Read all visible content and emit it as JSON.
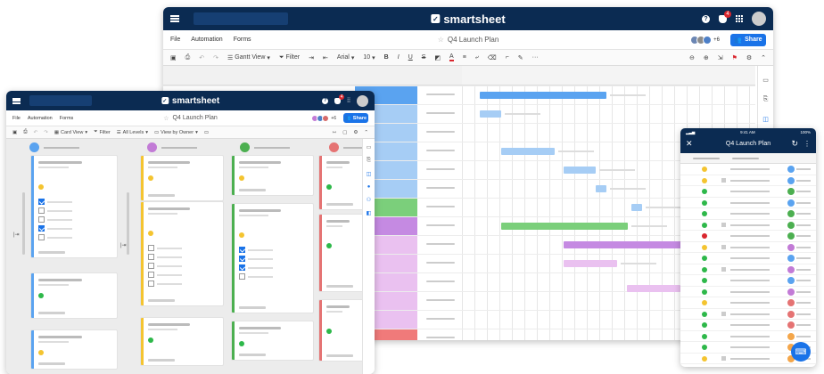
{
  "brand": {
    "name": "smartsheet",
    "logo_glyph": "✓"
  },
  "back_window": {
    "menus": [
      "File",
      "Automation",
      "Forms"
    ],
    "sheet_title": "Q4 Launch Plan",
    "collab_count": "+6",
    "share_label": "Share",
    "notif_count": "4",
    "toolbar": {
      "view": "Gantt View",
      "filter": "Filter",
      "font": "Arial",
      "size": "10"
    },
    "row_colors": [
      "#5aa3f0",
      "#a6cdf5",
      "#a6cdf5",
      "#a6cdf5",
      "#a6cdf5",
      "#a6cdf5",
      "#7bcf7b",
      "#c58ae2",
      "#eac1f0",
      "#eac1f0",
      "#eac1f0",
      "#eac1f0",
      "#eac1f0",
      "#f07a7a"
    ]
  },
  "front_window": {
    "menus": [
      "File",
      "Automation",
      "Forms"
    ],
    "sheet_title": "Q4 Launch Plan",
    "collab_count": "+6",
    "share_label": "Share",
    "notif_count": "4",
    "toolbar": {
      "view": "Card View",
      "filter": "Filter",
      "levels": "All Levels",
      "owner": "View by Owner"
    }
  },
  "mobile": {
    "time": "9:41 AM",
    "battery": "100%",
    "title": "Q4 Launch Plan",
    "status_dots": [
      "#f4c430",
      "#f4c430",
      "#2eb84a",
      "#2eb84a",
      "#2eb84a",
      "#2eb84a",
      "#d9262e",
      "#f4c430",
      "#2eb84a",
      "#2eb84a",
      "#2eb84a",
      "#2eb84a",
      "#f4c430",
      "#2eb84a",
      "#2eb84a",
      "#2eb84a",
      "#2eb84a",
      "#f4c430"
    ]
  },
  "colors": {
    "navy": "#0b2b52",
    "accent": "#1a73e8",
    "blue": "#5aa3f0",
    "green": "#7bcf7b",
    "purple": "#c58ae2",
    "pink": "#eac1f0",
    "red": "#f07a7a"
  }
}
